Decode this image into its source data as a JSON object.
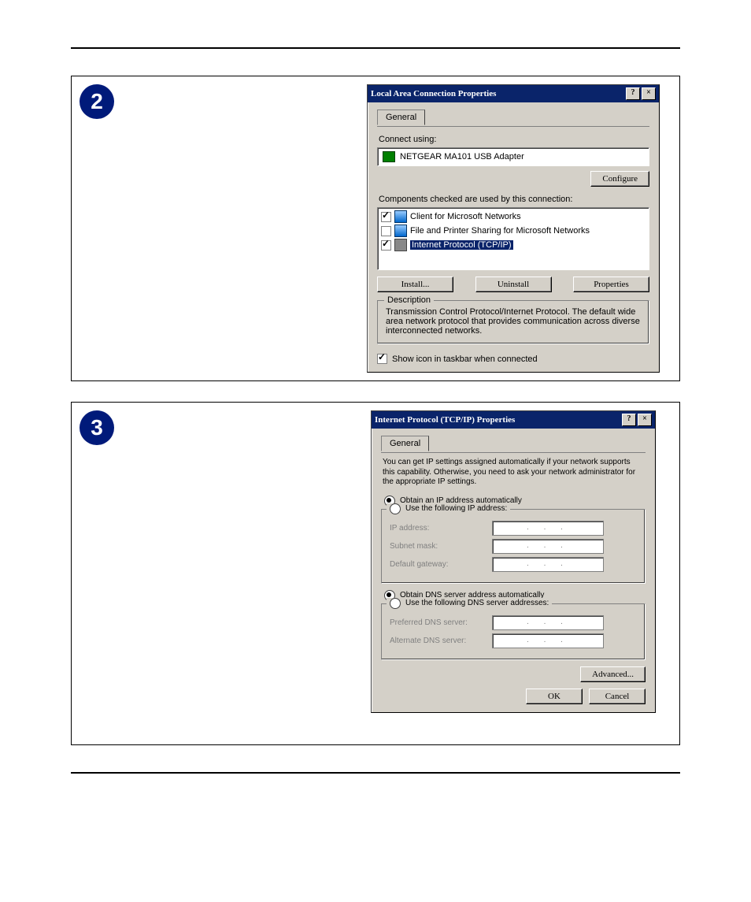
{
  "steps": {
    "s2": "2",
    "s3": "3"
  },
  "dlg1": {
    "title": "Local Area Connection Properties",
    "tab": "General",
    "connect_using_label": "Connect using:",
    "adapter": "NETGEAR MA101 USB Adapter",
    "configure": "Configure",
    "components_label": "Components checked are used by this connection:",
    "items": [
      {
        "checked": true,
        "label": "Client for Microsoft Networks"
      },
      {
        "checked": false,
        "label": "File and Printer Sharing for Microsoft Networks"
      },
      {
        "checked": true,
        "label": "Internet Protocol (TCP/IP)"
      }
    ],
    "install": "Install...",
    "uninstall": "Uninstall",
    "properties": "Properties",
    "group": "Description",
    "desc": "Transmission Control Protocol/Internet Protocol. The default wide area network protocol that provides communication across diverse interconnected networks.",
    "show_icon": "Show icon in taskbar when connected",
    "help": "?",
    "close": "×"
  },
  "dlg2": {
    "title": "Internet Protocol (TCP/IP) Properties",
    "tab": "General",
    "info": "You can get IP settings assigned automatically if your network supports this capability. Otherwise, you need to ask your network administrator for the appropriate IP settings.",
    "obtain_ip": "Obtain an IP address automatically",
    "use_ip": "Use the following IP address:",
    "ip_address": "IP address:",
    "subnet": "Subnet mask:",
    "gateway": "Default gateway:",
    "obtain_dns": "Obtain DNS server address automatically",
    "use_dns": "Use the following DNS server addresses:",
    "pref_dns": "Preferred DNS server:",
    "alt_dns": "Alternate DNS server:",
    "dots": ".   .   .",
    "advanced": "Advanced...",
    "ok": "OK",
    "cancel": "Cancel",
    "help": "?",
    "close": "×"
  }
}
